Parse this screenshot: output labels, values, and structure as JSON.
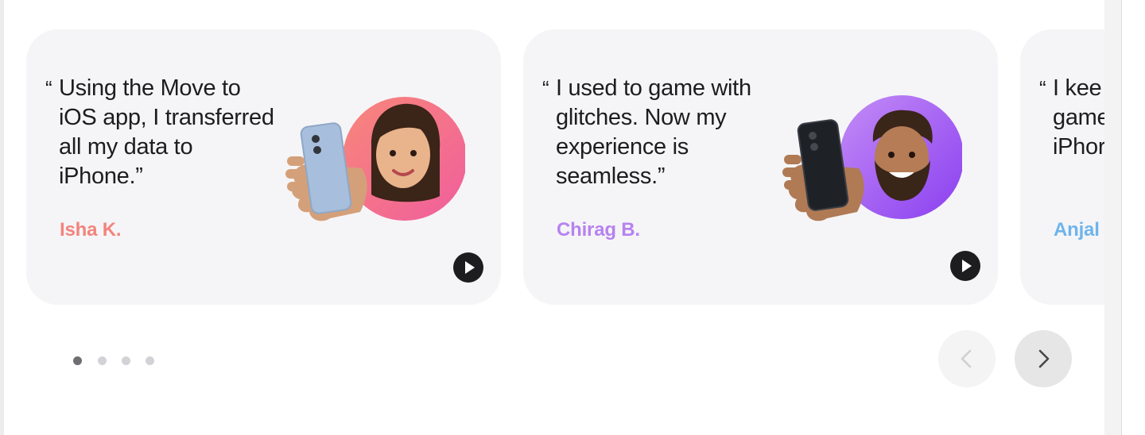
{
  "testimonials": [
    {
      "quote": "Using the Move to iOS app, I transferred all my data to iPhone.”",
      "name": "Isha K.",
      "accent": "#f2847c",
      "avatar_bg": [
        "#f8877a",
        "#f05e9c"
      ],
      "phone_color": "#a7bfdd",
      "play_icon": "play-icon"
    },
    {
      "quote": "I used to game with glitches. Now my experience is seamless.”",
      "name": "Chirag B.",
      "accent": "#b782f0",
      "avatar_bg": [
        "#c48cf6",
        "#8a3ff0"
      ],
      "phone_color": "#1e2126",
      "play_icon": "play-icon"
    },
    {
      "quote": "I kee game iPhor",
      "name": "Anjal",
      "accent": "#6fb4ec"
    }
  ],
  "quote_mark": "“",
  "pagination": {
    "count": 4,
    "active_index": 0
  },
  "nav": {
    "prev_icon": "chevron-left-icon",
    "next_icon": "chevron-right-icon"
  }
}
